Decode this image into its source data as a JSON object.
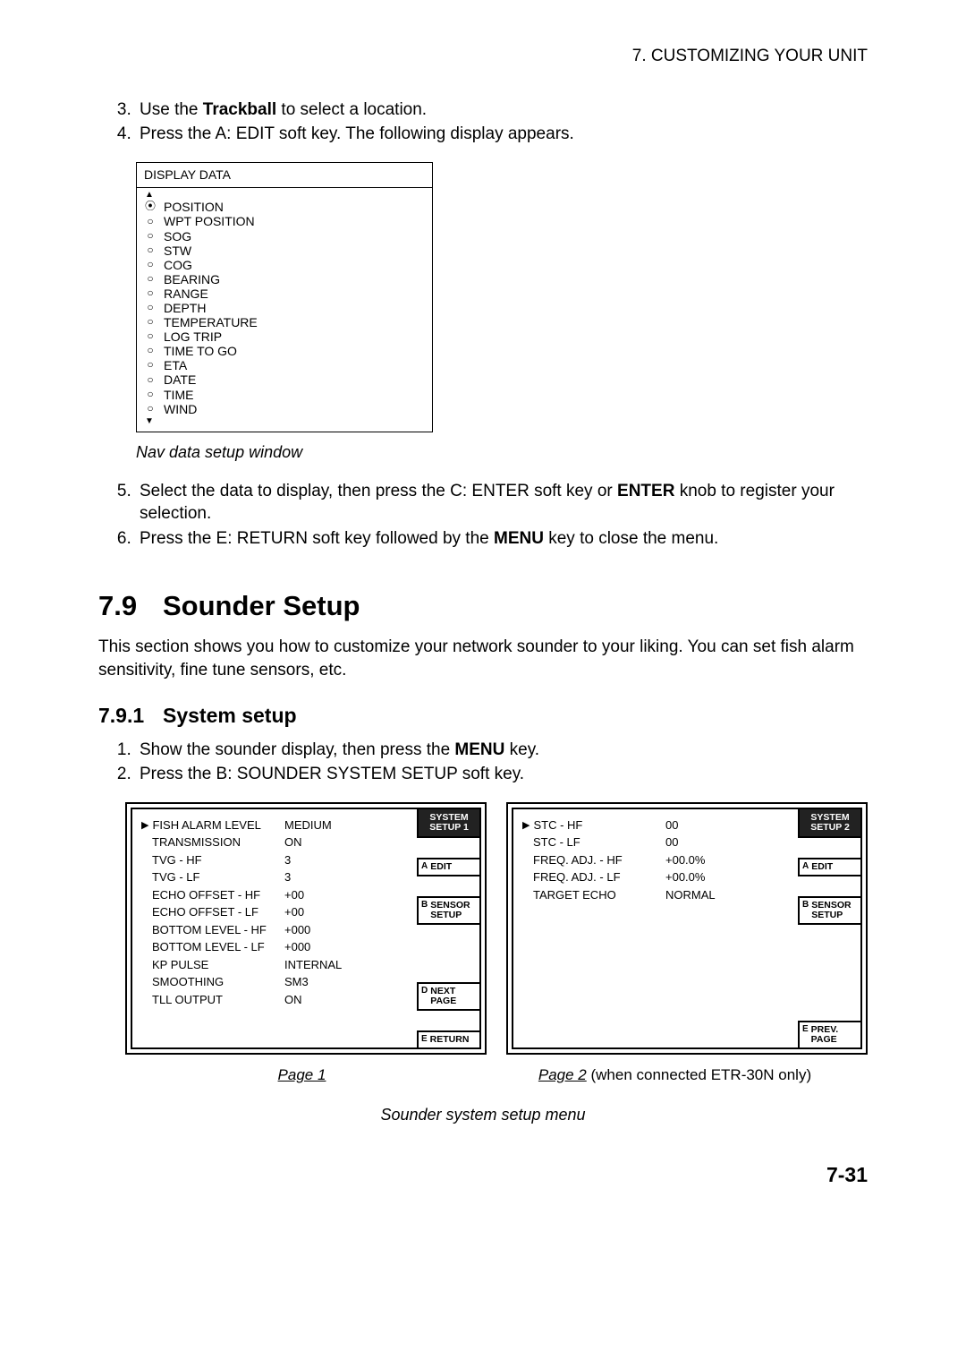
{
  "header": {
    "chapter": "7. CUSTOMIZING YOUR UNIT"
  },
  "steps_a": {
    "start": 3,
    "items": [
      {
        "pre": "Use the ",
        "bold": "Trackball",
        "post": " to select a location."
      },
      {
        "pre": "Press the A: EDIT soft key. The following display appears.",
        "bold": "",
        "post": ""
      }
    ]
  },
  "navwin": {
    "title": "DISPLAY DATA",
    "items": [
      {
        "mark": "⦿",
        "label": "POSITION"
      },
      {
        "mark": "○",
        "label": "WPT POSITION"
      },
      {
        "mark": "○",
        "label": "SOG"
      },
      {
        "mark": "○",
        "label": "STW"
      },
      {
        "mark": "○",
        "label": "COG"
      },
      {
        "mark": "○",
        "label": "BEARING"
      },
      {
        "mark": "○",
        "label": "RANGE"
      },
      {
        "mark": "○",
        "label": "DEPTH"
      },
      {
        "mark": "○",
        "label": "TEMPERATURE"
      },
      {
        "mark": "○",
        "label": "LOG TRIP"
      },
      {
        "mark": "○",
        "label": "TIME TO GO"
      },
      {
        "mark": "○",
        "label": "ETA"
      },
      {
        "mark": "○",
        "label": "DATE"
      },
      {
        "mark": "○",
        "label": "TIME"
      },
      {
        "mark": "○",
        "label": "WIND"
      }
    ],
    "caption": "Nav data setup window"
  },
  "steps_b": {
    "start": 5,
    "items": [
      {
        "text_parts": [
          "Select the data to display, then press the C: ENTER soft key or ",
          "ENTER",
          " knob to register your selection."
        ]
      },
      {
        "text_parts": [
          "Press the E: RETURN soft key followed by the ",
          "MENU",
          " key to close the menu."
        ]
      }
    ]
  },
  "section": {
    "num": "7.9",
    "title": "Sounder Setup",
    "intro": "This section shows you how to customize your network sounder to your liking. You can set fish alarm sensitivity, fine tune sensors, etc."
  },
  "subsection": {
    "num": "7.9.1",
    "title": "System setup",
    "steps": {
      "start": 1,
      "items": [
        {
          "text_parts": [
            "Show the sounder display, then press the ",
            "MENU",
            " key."
          ]
        },
        {
          "text_parts": [
            "Press the B: SOUNDER SYSTEM SETUP soft key.",
            "",
            ""
          ]
        }
      ]
    }
  },
  "panel1": {
    "header": "SYSTEM\nSETUP 1",
    "softkeys": [
      {
        "letter": "A",
        "txt": "EDIT"
      },
      {
        "letter": "B",
        "txt": "SENSOR\nSETUP"
      },
      {
        "letter": "D",
        "txt": "NEXT\nPAGE"
      },
      {
        "letter": "E",
        "txt": "RETURN"
      }
    ],
    "rows": [
      {
        "ptr": true,
        "label": "FISH ALARM LEVEL",
        "value": "MEDIUM"
      },
      {
        "ptr": false,
        "label": "TRANSMISSION",
        "value": "ON"
      },
      {
        "ptr": false,
        "label": "TVG - HF",
        "value": "3"
      },
      {
        "ptr": false,
        "label": "TVG - LF",
        "value": "3"
      },
      {
        "ptr": false,
        "label": "ECHO OFFSET - HF",
        "value": "+00"
      },
      {
        "ptr": false,
        "label": "ECHO OFFSET - LF",
        "value": "+00"
      },
      {
        "ptr": false,
        "label": "BOTTOM LEVEL - HF",
        "value": "+000"
      },
      {
        "ptr": false,
        "label": "BOTTOM LEVEL - LF",
        "value": "+000"
      },
      {
        "ptr": false,
        "label": "KP PULSE",
        "value": "INTERNAL"
      },
      {
        "ptr": false,
        "label": "SMOOTHING",
        "value": "SM3"
      },
      {
        "ptr": false,
        "label": "TLL OUTPUT",
        "value": "ON"
      }
    ]
  },
  "panel2": {
    "header": "SYSTEM\nSETUP 2",
    "softkeys": [
      {
        "letter": "A",
        "txt": "EDIT"
      },
      {
        "letter": "B",
        "txt": "SENSOR\nSETUP"
      },
      {
        "letter": "E",
        "txt": "PREV.\nPAGE"
      }
    ],
    "rows": [
      {
        "ptr": true,
        "label": "STC - HF",
        "value": "00"
      },
      {
        "ptr": false,
        "label": "STC - LF",
        "value": "00"
      },
      {
        "ptr": false,
        "label": "FREQ. ADJ. - HF",
        "value": "+00.0%"
      },
      {
        "ptr": false,
        "label": "FREQ. ADJ. - LF",
        "value": "+00.0%"
      },
      {
        "ptr": false,
        "label": "TARGET ECHO",
        "value": "NORMAL"
      }
    ]
  },
  "page_labels": {
    "p1": "Page 1",
    "p2": "Page 2",
    "p2_note": " (when connected ETR-30N only)"
  },
  "bottom_caption": "Sounder system setup menu",
  "footer": "7-31"
}
